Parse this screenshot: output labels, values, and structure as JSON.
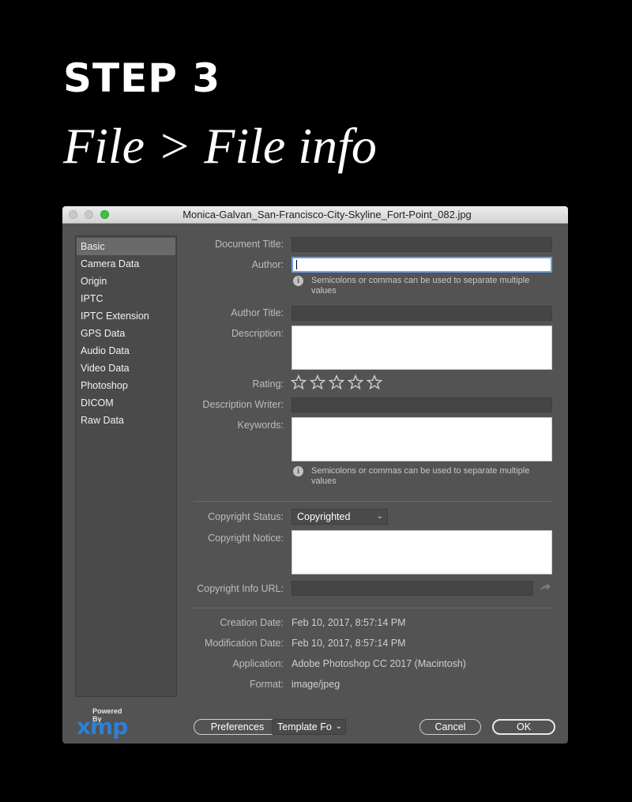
{
  "heading": {
    "step": "STEP 3",
    "subtitle": "File > File info"
  },
  "window": {
    "title": "Monica-Galvan_San-Francisco-City-Skyline_Fort-Point_082.jpg"
  },
  "sidebar": {
    "items": [
      {
        "label": "Basic",
        "active": true
      },
      {
        "label": "Camera Data"
      },
      {
        "label": "Origin"
      },
      {
        "label": "IPTC"
      },
      {
        "label": "IPTC Extension"
      },
      {
        "label": "GPS Data"
      },
      {
        "label": "Audio Data"
      },
      {
        "label": "Video Data"
      },
      {
        "label": "Photoshop"
      },
      {
        "label": "DICOM"
      },
      {
        "label": "Raw Data"
      }
    ]
  },
  "form": {
    "document_title_label": "Document Title:",
    "document_title_value": "",
    "author_label": "Author:",
    "author_value": "",
    "author_hint": "Semicolons or commas can be used to separate multiple values",
    "author_title_label": "Author Title:",
    "author_title_value": "",
    "description_label": "Description:",
    "description_value": "",
    "rating_label": "Rating:",
    "rating_value": 0,
    "rating_max": 5,
    "description_writer_label": "Description Writer:",
    "description_writer_value": "",
    "keywords_label": "Keywords:",
    "keywords_value": "",
    "keywords_hint": "Semicolons or commas can be used to separate multiple values",
    "copyright_status_label": "Copyright Status:",
    "copyright_status_value": "Copyrighted",
    "copyright_notice_label": "Copyright Notice:",
    "copyright_notice_value": "",
    "copyright_url_label": "Copyright Info URL:",
    "copyright_url_value": ""
  },
  "info": {
    "creation_date_label": "Creation Date:",
    "creation_date_value": "Feb 10, 2017, 8:57:14 PM",
    "modification_date_label": "Modification Date:",
    "modification_date_value": "Feb 10, 2017, 8:57:14 PM",
    "application_label": "Application:",
    "application_value": "Adobe Photoshop CC 2017 (Macintosh)",
    "format_label": "Format:",
    "format_value": "image/jpeg"
  },
  "footer": {
    "powered_by": "Powered By",
    "xmp_logo": "xmp",
    "preferences_label": "Preferences",
    "template_label": "Template Fo",
    "cancel_label": "Cancel",
    "ok_label": "OK"
  },
  "colors": {
    "accent": "#2e7fd6",
    "focus_ring": "#6aa0ea",
    "window_bg": "#535353"
  }
}
